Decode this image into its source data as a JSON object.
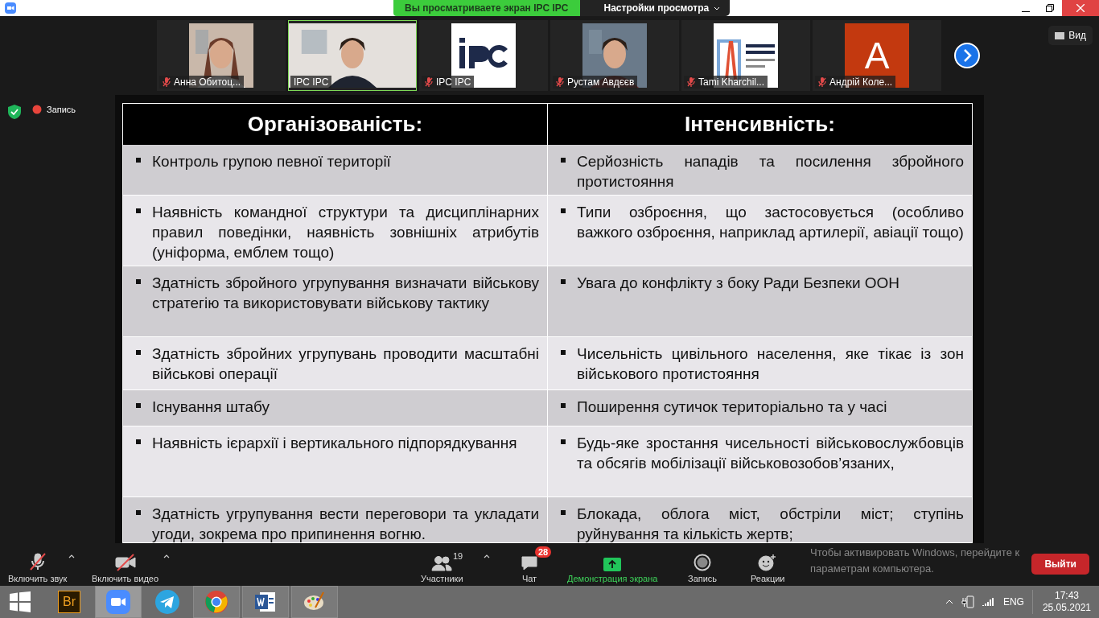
{
  "title_bar": {
    "banner": "Вы просматриваете экран IPC IPC",
    "view_options": "Настройки просмотра"
  },
  "participants": [
    {
      "name": "Анна Обитоц...",
      "muted": true,
      "speaking": false
    },
    {
      "name": "IPC IPC",
      "muted": false,
      "speaking": true
    },
    {
      "name": "IPC IPC",
      "muted": true,
      "speaking": false,
      "kind": "logo"
    },
    {
      "name": "Рустам Авдєєв",
      "muted": true,
      "speaking": false
    },
    {
      "name": "Tami Kharchil...",
      "muted": true,
      "speaking": false,
      "kind": "logo"
    },
    {
      "name": "Андрій Коле...",
      "muted": true,
      "speaking": false,
      "kind": "avatar",
      "initial": "A"
    }
  ],
  "view_button": "Вид",
  "recording": {
    "label": "Запись"
  },
  "slide": {
    "columns": [
      "Організованість:",
      "Інтенсивність:"
    ],
    "rows": [
      {
        "cells": [
          "Контроль групою певної території",
          "Серйозність нападів та посилення збройного протистояння"
        ]
      },
      {
        "cells": [
          "Наявність командної структури та дисциплінарних правил поведінки, наявність зовнішніх атрибутів (уніформа, емблем тощо)",
          "Типи озброєння, що застосовується (особливо важкого озброєння, наприклад артилерії, авіації тощо)"
        ]
      },
      {
        "cells": [
          "Здатність збройного угрупування визначати військову стратегію та використовувати військову тактику",
          "Увага до конфлікту з боку Ради Безпеки ООН"
        ]
      },
      {
        "cells": [
          "Здатність збройних угрупувань проводити масштабні військові операції",
          "Чисельність цивільного населення, яке тікає із зон військового протистояння"
        ]
      },
      {
        "cells": [
          "Існування штабу",
          "Поширення сутичок територіально та у часі"
        ]
      },
      {
        "cells": [
          "Наявність ієрархії і вертикального підпорядкування",
          "Будь-яке зростання чисельності військовослужбовців та обсягів мобілізації військовозобов’язаних,"
        ]
      },
      {
        "cells": [
          "Здатність угрупування вести переговори та укладати угоди, зокрема про припинення вогню.",
          "Блокада, облога міст, обстріли міст; ступінь руйнування та кількість жертв;"
        ]
      }
    ]
  },
  "toolbar": {
    "left": [
      {
        "kind": "mic",
        "label": "Включить звук",
        "off": true
      },
      {
        "kind": "camera",
        "label": "Включить видео",
        "off": true
      }
    ],
    "center": [
      {
        "kind": "participants",
        "label": "Участники",
        "count": "19"
      },
      {
        "kind": "chat",
        "label": "Чат",
        "badge": "28"
      },
      {
        "kind": "share",
        "label": "Демонстрация экрана",
        "active": true
      },
      {
        "kind": "record",
        "label": "Запись"
      },
      {
        "kind": "reactions",
        "label": "Реакции"
      }
    ],
    "leave": "Выйти"
  },
  "activation_notice": "Чтобы активировать Windows, перейдите к параметрам компьютера.",
  "taskbar": {
    "apps": [
      {
        "kind": "start",
        "open": false,
        "selected": false
      },
      {
        "kind": "bridge",
        "label": "Br",
        "open": false,
        "selected": false
      },
      {
        "kind": "zoom",
        "open": true,
        "selected": true
      },
      {
        "kind": "telegram",
        "open": false,
        "selected": false
      },
      {
        "kind": "chrome",
        "open": true,
        "selected": false
      },
      {
        "kind": "word",
        "open": true,
        "selected": false
      },
      {
        "kind": "paint",
        "open": true,
        "selected": false
      }
    ],
    "language": "ENG",
    "time": "17:43",
    "date": "25.05.2021"
  }
}
